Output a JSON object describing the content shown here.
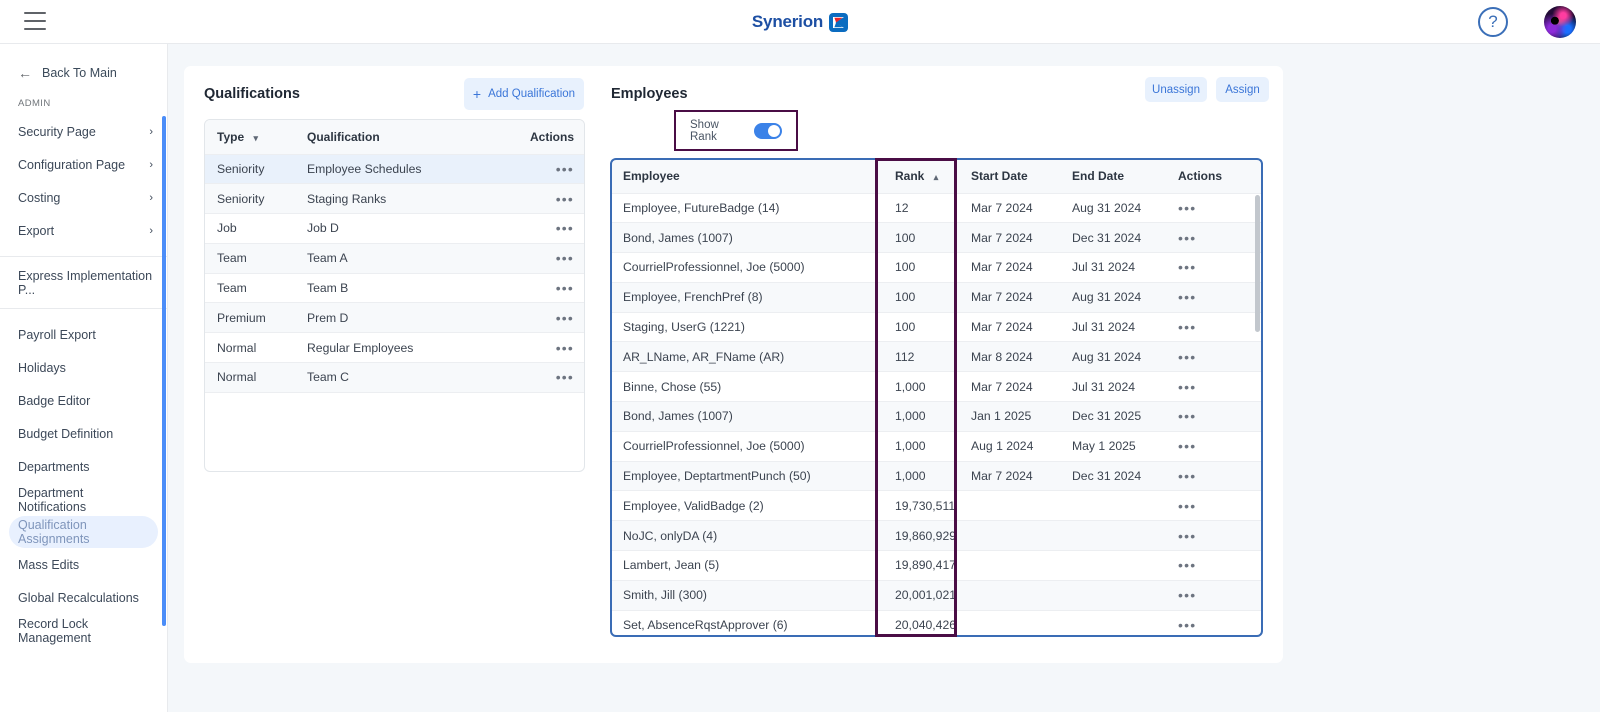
{
  "topbar": {
    "menu_icon": "hamburger-icon",
    "brand_name": "Synerion",
    "help_icon": "?",
    "avatar_alt": "user-avatar"
  },
  "sidebar": {
    "back_label": "Back To Main",
    "back_icon": "arrow-left-icon",
    "section_label": "ADMIN",
    "expandable": [
      {
        "label": "Security Page",
        "chevron": "›"
      },
      {
        "label": "Configuration Page",
        "chevron": "›"
      },
      {
        "label": "Costing",
        "chevron": "›"
      },
      {
        "label": "Export",
        "chevron": "›"
      }
    ],
    "express": {
      "label": "Express Implementation P..."
    },
    "items": [
      {
        "label": "Payroll Export",
        "active": false
      },
      {
        "label": "Holidays",
        "active": false
      },
      {
        "label": "Badge Editor",
        "active": false
      },
      {
        "label": "Budget Definition",
        "active": false
      },
      {
        "label": "Departments",
        "active": false
      },
      {
        "label": "Department Notifications",
        "active": false
      },
      {
        "label": "Qualification Assignments",
        "active": true
      },
      {
        "label": "Mass Edits",
        "active": false
      },
      {
        "label": "Global Recalculations",
        "active": false
      },
      {
        "label": "Record Lock Management",
        "active": false
      }
    ]
  },
  "qualifications": {
    "title": "Qualifications",
    "add_button": "Add Qualification",
    "add_icon": "plus-icon",
    "columns": [
      "Type",
      "Qualification",
      "Actions"
    ],
    "sorted_column": "Type",
    "sort_direction": "desc",
    "sort_caret": "▾",
    "actions_glyph": "•••",
    "rows": [
      {
        "type": "Seniority",
        "qualification": "Employee Schedules"
      },
      {
        "type": "Seniority",
        "qualification": "Staging Ranks"
      },
      {
        "type": "Job",
        "qualification": "Job D"
      },
      {
        "type": "Team",
        "qualification": "Team A"
      },
      {
        "type": "Team",
        "qualification": "Team B"
      },
      {
        "type": "Premium",
        "qualification": "Prem D"
      },
      {
        "type": "Normal",
        "qualification": "Regular Employees"
      },
      {
        "type": "Normal",
        "qualification": "Team C"
      }
    ]
  },
  "employees": {
    "title": "Employees",
    "show_rank_label": "Show Rank",
    "show_rank_on": true,
    "unassign_button": "Unassign",
    "assign_button": "Assign",
    "columns": [
      "Employee",
      "Rank",
      "Start Date",
      "End Date",
      "Actions"
    ],
    "sorted_column": "Rank",
    "sort_direction": "asc",
    "sort_caret": "▴",
    "actions_glyph": "•••",
    "rows": [
      {
        "employee": "Employee, FutureBadge (14)",
        "rank": "12",
        "start": "Mar 7 2024",
        "end": "Aug 31 2024"
      },
      {
        "employee": "Bond, James (1007)",
        "rank": "100",
        "start": "Mar 7 2024",
        "end": "Dec 31 2024"
      },
      {
        "employee": "CourrielProfessionnel, Joe (5000)",
        "rank": "100",
        "start": "Mar 7 2024",
        "end": "Jul 31 2024"
      },
      {
        "employee": "Employee, FrenchPref (8)",
        "rank": "100",
        "start": "Mar 7 2024",
        "end": "Aug 31 2024"
      },
      {
        "employee": "Staging, UserG (1221)",
        "rank": "100",
        "start": "Mar 7 2024",
        "end": "Jul 31 2024"
      },
      {
        "employee": "AR_LName, AR_FName (AR)",
        "rank": "112",
        "start": "Mar 8 2024",
        "end": "Aug 31 2024"
      },
      {
        "employee": "Binne, Chose (55)",
        "rank": "1,000",
        "start": "Mar 7 2024",
        "end": "Jul 31 2024"
      },
      {
        "employee": "Bond, James (1007)",
        "rank": "1,000",
        "start": "Jan 1 2025",
        "end": "Dec 31 2025"
      },
      {
        "employee": "CourrielProfessionnel, Joe (5000)",
        "rank": "1,000",
        "start": "Aug 1 2024",
        "end": "May 1 2025"
      },
      {
        "employee": "Employee, DeptartmentPunch (50)",
        "rank": "1,000",
        "start": "Mar 7 2024",
        "end": "Dec 31 2024"
      },
      {
        "employee": "Employee, ValidBadge (2)",
        "rank": "19,730,511",
        "start": "",
        "end": ""
      },
      {
        "employee": "NoJC, onlyDA (4)",
        "rank": "19,860,929",
        "start": "",
        "end": ""
      },
      {
        "employee": "Lambert, Jean (5)",
        "rank": "19,890,417",
        "start": "",
        "end": ""
      },
      {
        "employee": "Smith, Jill (300)",
        "rank": "20,001,021",
        "start": "",
        "end": ""
      },
      {
        "employee": "Set, AbsenceRqstApprover (6)",
        "rank": "20,040,426",
        "start": "",
        "end": ""
      }
    ]
  },
  "colors": {
    "brand_blue": "#1d4fa3",
    "accent_blue": "#3b76d8",
    "toggle_on": "#3b82e8",
    "highlight_blue": "#3a6cb5",
    "highlight_purple": "#4a0d45",
    "active_nav_bg": "#e8f0fe",
    "page_bg": "#f4f7fa"
  }
}
